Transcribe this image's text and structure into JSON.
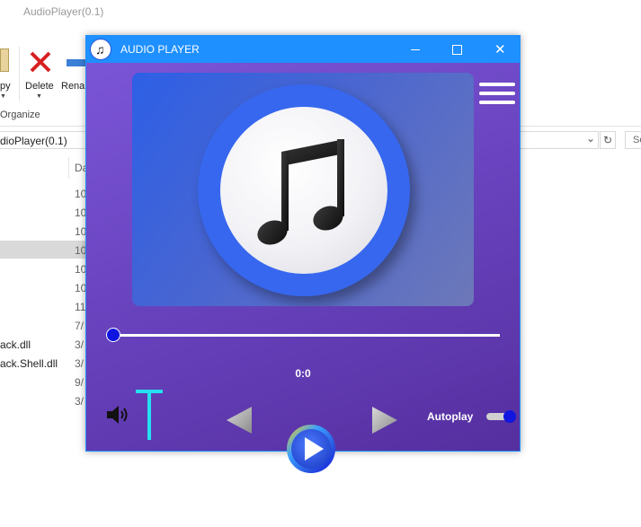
{
  "explorer": {
    "title": "AudioPlayer(0.1)",
    "ribbon": {
      "copy_label": "py",
      "delete_label": "Delete",
      "rename_label": "Rena",
      "group_label": "Organize"
    },
    "address": "dioPlayer(0.1)",
    "search_hint": "Se",
    "date_header": "Da",
    "date_cells": [
      "10",
      "10",
      "10",
      "10",
      "10",
      "10",
      "11",
      "7/",
      "3/",
      "3/",
      "9/",
      "3/"
    ],
    "file_names": [
      "ack.dll",
      "ack.Shell.dll"
    ]
  },
  "player": {
    "title": "AUDIO PLAYER",
    "time": "0:0",
    "autoplay_label": "Autoplay",
    "autoplay_on": true,
    "seek_fraction": 0.0,
    "colors": {
      "titlebar": "#1e90ff",
      "background": "#6a44c0",
      "accent": "#1016e0",
      "volume": "#25e0f0"
    },
    "icons": {
      "app": "music-note-icon",
      "menu": "hamburger-menu-icon",
      "volume": "speaker-icon",
      "prev": "previous-icon",
      "play": "play-icon",
      "next": "next-icon"
    }
  }
}
